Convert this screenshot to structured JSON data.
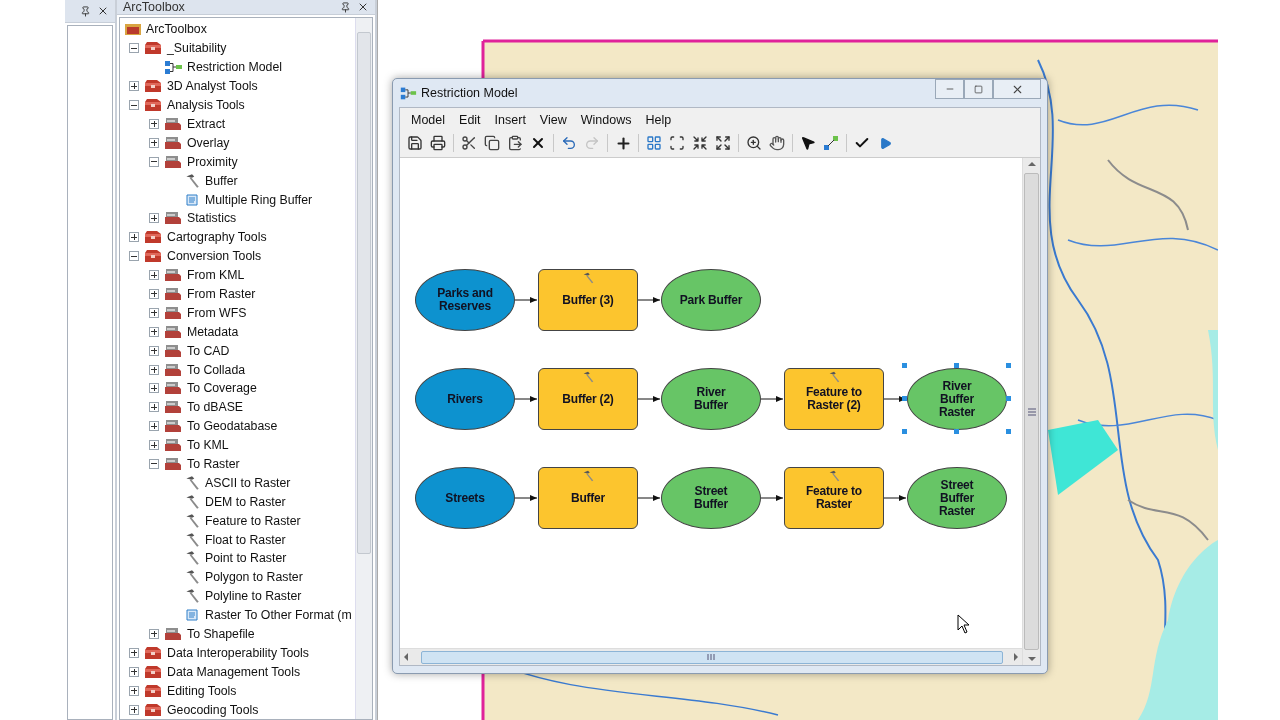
{
  "toolbox_panel": {
    "title": "ArcToolbox",
    "tree": {
      "label": "ArcToolbox",
      "kind": "root",
      "children": [
        {
          "label": "_Suitability",
          "kind": "toolbox",
          "expanded": true,
          "children": [
            {
              "label": "Restriction Model",
              "kind": "model"
            }
          ]
        },
        {
          "label": "3D Analyst Tools",
          "kind": "toolbox",
          "expanded": false
        },
        {
          "label": "Analysis Tools",
          "kind": "toolbox",
          "expanded": true,
          "children": [
            {
              "label": "Extract",
              "kind": "toolset",
              "expanded": false
            },
            {
              "label": "Overlay",
              "kind": "toolset",
              "expanded": false
            },
            {
              "label": "Proximity",
              "kind": "toolset",
              "expanded": true,
              "children": [
                {
                  "label": "Buffer",
                  "kind": "tool"
                },
                {
                  "label": "Multiple Ring Buffer",
                  "kind": "script"
                }
              ]
            },
            {
              "label": "Statistics",
              "kind": "toolset",
              "expanded": false
            }
          ]
        },
        {
          "label": "Cartography Tools",
          "kind": "toolbox",
          "expanded": false
        },
        {
          "label": "Conversion Tools",
          "kind": "toolbox",
          "expanded": true,
          "children": [
            {
              "label": "From KML",
              "kind": "toolset",
              "expanded": false
            },
            {
              "label": "From Raster",
              "kind": "toolset",
              "expanded": false
            },
            {
              "label": "From WFS",
              "kind": "toolset",
              "expanded": false
            },
            {
              "label": "Metadata",
              "kind": "toolset",
              "expanded": false
            },
            {
              "label": "To CAD",
              "kind": "toolset",
              "expanded": false
            },
            {
              "label": "To Collada",
              "kind": "toolset",
              "expanded": false
            },
            {
              "label": "To Coverage",
              "kind": "toolset",
              "expanded": false
            },
            {
              "label": "To dBASE",
              "kind": "toolset",
              "expanded": false
            },
            {
              "label": "To Geodatabase",
              "kind": "toolset",
              "expanded": false
            },
            {
              "label": "To KML",
              "kind": "toolset",
              "expanded": false
            },
            {
              "label": "To Raster",
              "kind": "toolset",
              "expanded": true,
              "children": [
                {
                  "label": "ASCII to Raster",
                  "kind": "tool"
                },
                {
                  "label": "DEM to Raster",
                  "kind": "tool"
                },
                {
                  "label": "Feature to Raster",
                  "kind": "tool"
                },
                {
                  "label": "Float to Raster",
                  "kind": "tool"
                },
                {
                  "label": "Point to Raster",
                  "kind": "tool"
                },
                {
                  "label": "Polygon to Raster",
                  "kind": "tool"
                },
                {
                  "label": "Polyline to Raster",
                  "kind": "tool"
                },
                {
                  "label": "Raster To Other Format (m",
                  "kind": "script"
                }
              ]
            },
            {
              "label": "To Shapefile",
              "kind": "toolset",
              "expanded": false
            }
          ]
        },
        {
          "label": "Data Interoperability Tools",
          "kind": "toolbox",
          "expanded": false
        },
        {
          "label": "Data Management Tools",
          "kind": "toolbox",
          "expanded": false
        },
        {
          "label": "Editing Tools",
          "kind": "toolbox",
          "expanded": false
        },
        {
          "label": "Geocoding Tools",
          "kind": "toolbox",
          "expanded": false
        }
      ]
    }
  },
  "model_window": {
    "title": "Restriction Model",
    "menu": [
      "Model",
      "Edit",
      "Insert",
      "View",
      "Windows",
      "Help"
    ],
    "diagram_rows": [
      {
        "nodes": [
          {
            "kind": "input",
            "label": "Parks and\nReserves",
            "selected": false
          },
          {
            "kind": "tool",
            "label": "Buffer (3)",
            "selected": false
          },
          {
            "kind": "output",
            "label": "Park Buffer",
            "selected": false
          }
        ]
      },
      {
        "nodes": [
          {
            "kind": "input",
            "label": "Rivers",
            "selected": false
          },
          {
            "kind": "tool",
            "label": "Buffer (2)",
            "selected": false
          },
          {
            "kind": "output",
            "label": "River\nBuffer",
            "selected": false
          },
          {
            "kind": "tool",
            "label": "Feature to\nRaster (2)",
            "selected": false
          },
          {
            "kind": "output",
            "label": "River\nBuffer\nRaster",
            "selected": true
          }
        ]
      },
      {
        "nodes": [
          {
            "kind": "input",
            "label": "Streets",
            "selected": false
          },
          {
            "kind": "tool",
            "label": "Buffer",
            "selected": false
          },
          {
            "kind": "output",
            "label": "Street\nBuffer",
            "selected": false
          },
          {
            "kind": "tool",
            "label": "Feature to\nRaster",
            "selected": false
          },
          {
            "kind": "output",
            "label": "Street\nBuffer\nRaster",
            "selected": false
          }
        ]
      }
    ]
  }
}
